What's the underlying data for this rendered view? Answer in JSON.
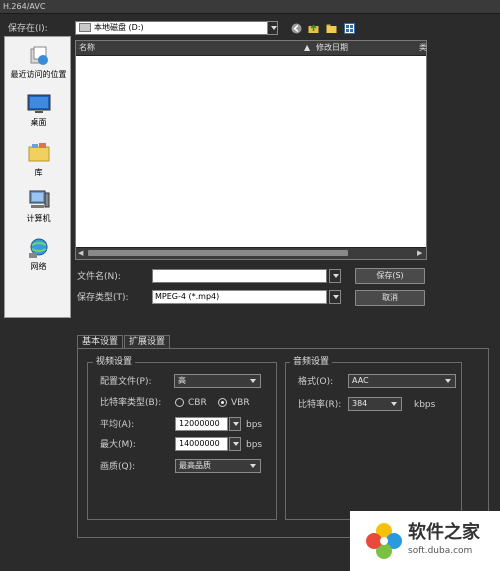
{
  "window": {
    "title": "H.264/AVC"
  },
  "location": {
    "label": "保存在(I):",
    "value": "本地磁盘 (D:)"
  },
  "places": [
    {
      "id": "recent",
      "label": "最近访问的位置"
    },
    {
      "id": "desktop",
      "label": "桌面"
    },
    {
      "id": "libraries",
      "label": "库"
    },
    {
      "id": "computer",
      "label": "计算机"
    },
    {
      "id": "network",
      "label": "网络"
    }
  ],
  "file_list": {
    "columns": [
      "名称",
      "修改日期",
      "类"
    ]
  },
  "filename": {
    "label": "文件名(N):",
    "value": ""
  },
  "filetype": {
    "label": "保存类型(T):",
    "value": "MPEG-4 (*.mp4)"
  },
  "buttons": {
    "save": "保存(S)",
    "cancel": "取消"
  },
  "tabs": [
    {
      "label": "基本设置"
    },
    {
      "label": "扩展设置"
    }
  ],
  "video": {
    "title": "视频设置",
    "profile_label": "配置文件(P):",
    "profile_value": "高",
    "bitrate_type_label": "比特率类型(B):",
    "cbr": "CBR",
    "vbr": "VBR",
    "avg_label": "平均(A):",
    "avg_value": "12000000",
    "avg_unit": "bps",
    "max_label": "最大(M):",
    "max_value": "14000000",
    "max_unit": "bps",
    "quality_label": "画质(Q):",
    "quality_value": "最高品质"
  },
  "audio": {
    "title": "音频设置",
    "format_label": "格式(O):",
    "format_value": "AAC",
    "bitrate_label": "比特率(R):",
    "bitrate_value": "384",
    "bitrate_unit": "kbps"
  },
  "watermark": {
    "brand": "软件之家",
    "url": "soft.duba.com"
  }
}
